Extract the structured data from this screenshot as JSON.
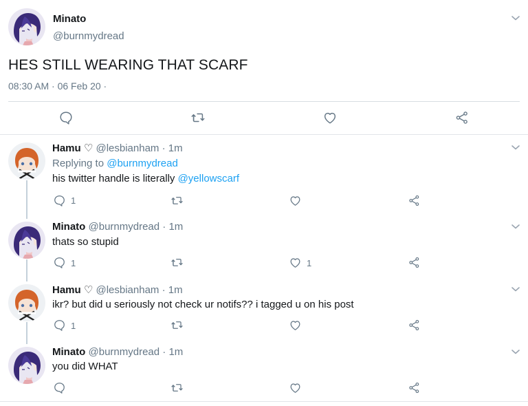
{
  "main_tweet": {
    "name": "Minato",
    "handle": "@burnmydread",
    "text": "HES STILL WEARING THAT SCARF",
    "meta": "08:30 AM · 06 Feb 20 ·"
  },
  "icons": {
    "reply": "speech-bubble-icon",
    "retweet": "retweet-arrows-icon",
    "like": "heart-icon",
    "share": "share-icon",
    "menu": "chevron-down-icon"
  },
  "replies": [
    {
      "name": "Hamu ♡",
      "handle": "@lesbianham",
      "time": "· 1m",
      "replying_prefix": "Replying to ",
      "replying_to": "@burnmydread",
      "text_prefix": "his twitter handle is literally ",
      "text_link": "@yellowscarf",
      "reply_count": "1",
      "like_count": ""
    },
    {
      "name": "Minato",
      "handle": "@burnmydread",
      "time": "· 1m",
      "text": "thats so stupid",
      "reply_count": "1",
      "like_count": "1"
    },
    {
      "name": "Hamu ♡",
      "handle": "@lesbianham",
      "time": "· 1m",
      "text": "ikr? but did u seriously not check ur notifs?? i tagged u on his post",
      "reply_count": "1",
      "like_count": ""
    },
    {
      "name": "Minato",
      "handle": "@burnmydread",
      "time": "· 1m",
      "text": "you did WHAT",
      "reply_count": "",
      "like_count": ""
    }
  ],
  "colors": {
    "link": "#1da1f2",
    "muted": "#657786",
    "thread_line": "#c4d0da",
    "minato_hair": "#3a2a78",
    "hamu_hair": "#d4642a"
  }
}
